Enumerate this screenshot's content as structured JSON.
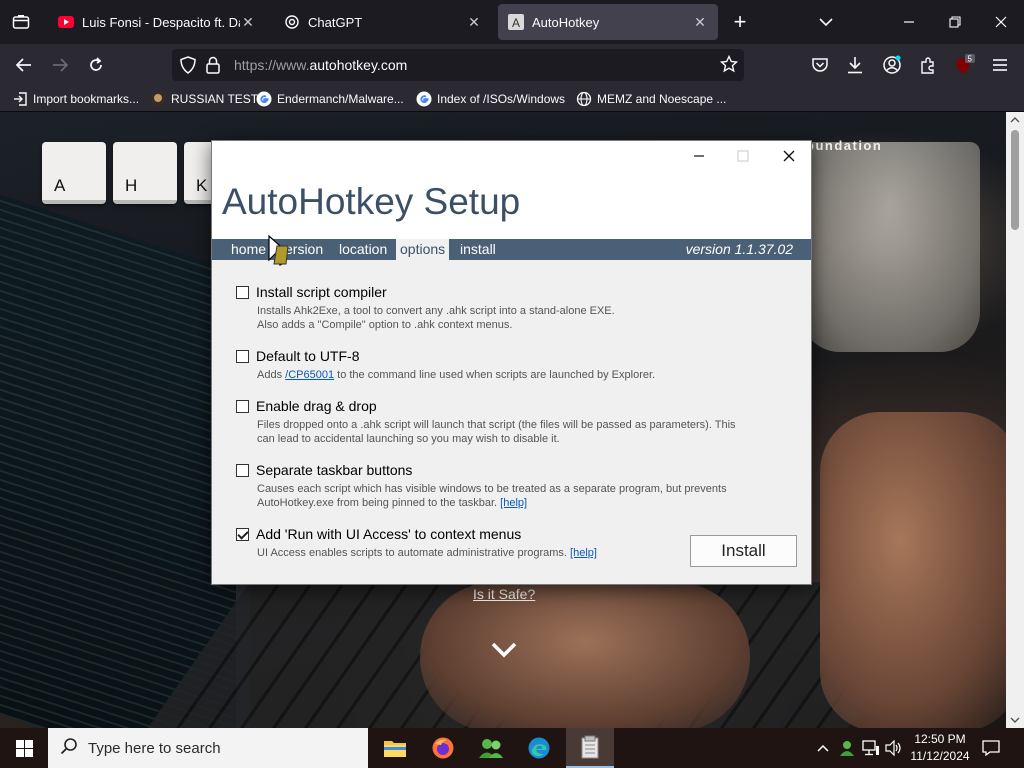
{
  "browser": {
    "tabs": [
      {
        "title": "Luis Fonsi - Despacito ft. Daddy",
        "icon": "youtube-icon",
        "active": false
      },
      {
        "title": "ChatGPT",
        "icon": "chatgpt-icon",
        "active": false
      },
      {
        "title": "AutoHotkey",
        "icon": "autohotkey-icon",
        "active": true
      }
    ],
    "url": {
      "scheme": "https://www.",
      "host": "autohotkey.com"
    },
    "extension_badge": "5",
    "bookmarks": [
      {
        "label": "Import bookmarks...",
        "icon": "import-icon"
      },
      {
        "label": "RUSSIAN TEST",
        "icon": "mask-icon"
      },
      {
        "label": "Endermanch/Malware...",
        "icon": "google-icon"
      },
      {
        "label": "Index of /ISOs/Windows",
        "icon": "google-icon"
      },
      {
        "label": "MEMZ and Noescape ...",
        "icon": "globe-icon"
      }
    ]
  },
  "page": {
    "key_tiles": [
      "A",
      "H",
      "K"
    ],
    "tagline_fragment": "oundation",
    "safe_link": "Is it Safe?"
  },
  "dialog": {
    "title": "AutoHotkey Setup",
    "nav": [
      "home",
      "version",
      "location",
      "options",
      "install"
    ],
    "active_nav": "options",
    "version_label": "version 1.1.37.02",
    "options": [
      {
        "title": "Install script compiler",
        "checked": false,
        "desc_1": "Installs Ahk2Exe, a tool to convert any .ahk script into a stand-alone EXE.",
        "desc_2": "Also adds a \"Compile\" option to .ahk context menus."
      },
      {
        "title": "Default to UTF-8",
        "checked": false,
        "desc_pre": "Adds ",
        "desc_link": "/CP65001",
        "desc_post": " to the command line used when scripts are launched by Explorer."
      },
      {
        "title": "Enable drag & drop",
        "checked": false,
        "desc": "Files dropped onto a .ahk script will launch that script (the files will be passed as parameters). This can lead to accidental launching so you may wish to disable it."
      },
      {
        "title": "Separate taskbar buttons",
        "checked": false,
        "desc": "Causes each script which has visible windows to be treated as a separate program, but prevents AutoHotkey.exe from being pinned to the taskbar. ",
        "desc_link": "[help]"
      },
      {
        "title": "Add 'Run with UI Access' to context menus",
        "checked": true,
        "desc": "UI Access enables scripts to automate administrative programs. ",
        "desc_link": "[help]"
      }
    ],
    "install_label": "Install"
  },
  "taskbar": {
    "search_placeholder": "Type here to search",
    "apps": [
      "file-explorer-icon",
      "firefox-icon",
      "people-icon",
      "edge-icon",
      "installer-icon"
    ],
    "time": "12:50 PM",
    "date": "11/12/2024"
  },
  "colors": {
    "dialog_title": "#3b5067",
    "dialog_nav": "#4a6076",
    "link": "#0a58b8",
    "browser_bg": "#1c1b22"
  }
}
